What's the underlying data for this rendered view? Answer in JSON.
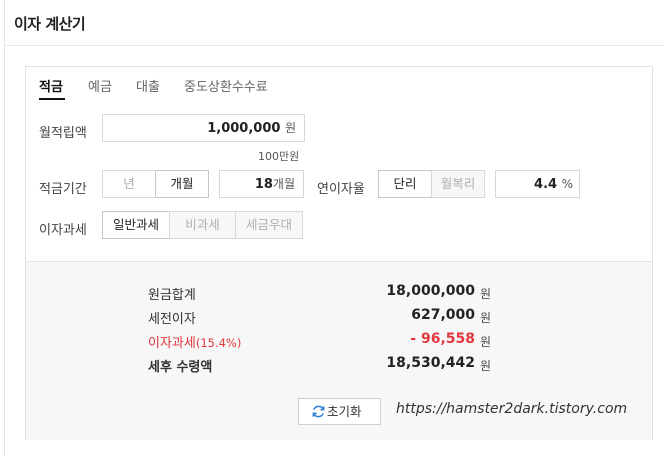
{
  "header": {
    "title": "이자 계산기"
  },
  "tabs": [
    {
      "label": "적금",
      "active": true
    },
    {
      "label": "예금",
      "active": false
    },
    {
      "label": "대출",
      "active": false
    },
    {
      "label": "중도상환수수료",
      "active": false
    }
  ],
  "form": {
    "monthly_deposit": {
      "label": "월적립액",
      "value": "1,000,000",
      "unit": "원",
      "hint": "100만원"
    },
    "period": {
      "label": "적금기간",
      "options": [
        "년",
        "개월"
      ],
      "selected": "개월",
      "value": "18",
      "unit": "개월"
    },
    "rate": {
      "label": "연이자율",
      "options": [
        "단리",
        "월복리"
      ],
      "selected": "단리",
      "value": "4.4",
      "unit": "%"
    },
    "tax": {
      "label": "이자과세",
      "options": [
        "일반과세",
        "비과세",
        "세금우대"
      ],
      "selected": "일반과세"
    }
  },
  "result": {
    "rows": [
      {
        "label": "원금합계",
        "value": "18,000,000",
        "unit": "원"
      },
      {
        "label": "세전이자",
        "value": "627,000",
        "unit": "원"
      },
      {
        "label": "이자과세",
        "sub": "(15.4%)",
        "value": "- 96,558",
        "unit": "원"
      },
      {
        "label": "세후 수령액",
        "value": "18,530,442",
        "unit": "원"
      }
    ],
    "reset_label": "초기화",
    "url_text": "https://hamster2dark.tistory.com"
  },
  "colors": {
    "accent_red": "#e0383e",
    "result_bg": "#f7f7f7"
  }
}
